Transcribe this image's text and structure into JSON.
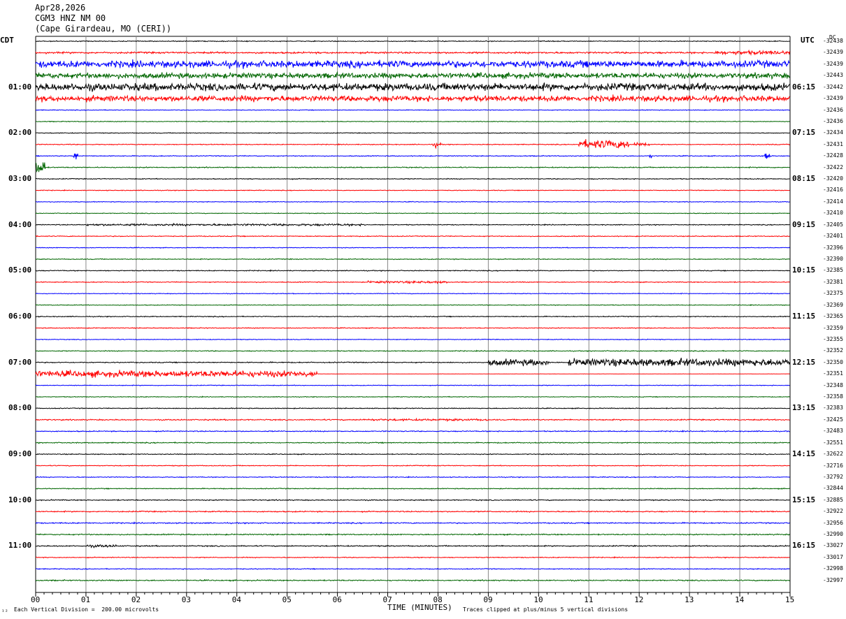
{
  "header": {
    "date": "Apr28,2026",
    "station": "CGM3 HNZ NM 00",
    "location": "(Cape Girardeau, MO (CERI))"
  },
  "left_tz": "CDT",
  "right_tz": "UTC",
  "dc_header": "DC",
  "footer": {
    "scale": "Each Vertical Division =  200.00 microvolts",
    "clip": "Traces clipped at plus/minus 5 vertical divisions",
    "xlabel": "TIME (MINUTES)",
    "corner_mark": "¹²"
  },
  "chart_data": {
    "type": "line",
    "title": "",
    "xlabel": "TIME (MINUTES)",
    "ylabel": "",
    "xlim": [
      0,
      15
    ],
    "x_ticks": [
      "00",
      "01",
      "02",
      "03",
      "04",
      "05",
      "06",
      "07",
      "08",
      "09",
      "10",
      "11",
      "12",
      "13",
      "14",
      "15"
    ],
    "trace_minutes": 15,
    "trace_colors": [
      "#000000",
      "#ff0000",
      "#0000ff",
      "#006600"
    ],
    "grid": true,
    "left_hour_labels": [
      "01:00",
      "02:00",
      "03:00",
      "04:00",
      "05:00",
      "06:00",
      "07:00",
      "08:00",
      "09:00",
      "10:00",
      "11:00"
    ],
    "right_hour_labels": [
      "06:15",
      "07:15",
      "08:15",
      "09:15",
      "10:15",
      "11:15",
      "12:15",
      "13:15",
      "14:15",
      "15:15",
      "16:15"
    ],
    "dc_offsets": [
      "-32438",
      "-32439",
      "-32439",
      "-32443",
      "-32442",
      "-32439",
      "-32436",
      "-32436",
      "-32434",
      "-32431",
      "-32428",
      "-32422",
      "-32420",
      "-32416",
      "-32414",
      "-32410",
      "-32405",
      "-32401",
      "-32396",
      "-32390",
      "-32385",
      "-32381",
      "-32375",
      "-32369",
      "-32365",
      "-32359",
      "-32355",
      "-32352",
      "-32350",
      "-32351",
      "-32348",
      "-32358",
      "-32383",
      "-32425",
      "-32483",
      "-32551",
      "-32622",
      "-32716",
      "-32792",
      "-32844",
      "-32885",
      "-32922",
      "-32956",
      "-32990",
      "-33027",
      "-33017",
      "-32998",
      "-32997"
    ],
    "noise_amplitude_divisions": [
      0.3,
      0.5,
      2.4,
      1.9,
      2.6,
      2.0,
      0.25,
      0.25,
      0.25,
      0.3,
      0.3,
      0.35,
      0.3,
      0.25,
      0.25,
      0.25,
      0.3,
      0.3,
      0.25,
      0.3,
      0.3,
      0.3,
      0.25,
      0.25,
      0.3,
      0.3,
      0.25,
      0.3,
      0.35,
      0.4,
      0.25,
      0.25,
      0.3,
      0.4,
      0.35,
      0.35,
      0.3,
      0.3,
      0.3,
      0.3,
      0.35,
      0.4,
      0.4,
      0.4,
      0.4,
      0.3,
      0.3,
      0.4
    ],
    "events": [
      {
        "trace": 1,
        "start": 0,
        "end": 15,
        "amp": 0.6
      },
      {
        "trace": 1,
        "start": 13.5,
        "end": 15,
        "amp": 1.4
      },
      {
        "trace": 9,
        "start": 7.9,
        "end": 8.05,
        "amp": 1.8
      },
      {
        "trace": 9,
        "start": 10.8,
        "end": 11.8,
        "amp": 3.0
      },
      {
        "trace": 9,
        "start": 11.9,
        "end": 12.2,
        "amp": 1.4
      },
      {
        "trace": 10,
        "start": 0.75,
        "end": 0.85,
        "amp": 3.0
      },
      {
        "trace": 10,
        "start": 12.2,
        "end": 12.25,
        "amp": 3.0
      },
      {
        "trace": 10,
        "start": 14.5,
        "end": 14.6,
        "amp": 2.6
      },
      {
        "trace": 11,
        "start": 0.0,
        "end": 0.2,
        "amp": 5.0
      },
      {
        "trace": 16,
        "start": 1.0,
        "end": 6.6,
        "amp": 0.7
      },
      {
        "trace": 21,
        "start": 6.6,
        "end": 8.2,
        "amp": 0.8
      },
      {
        "trace": 28,
        "start": 9.0,
        "end": 10.2,
        "amp": 2.2
      },
      {
        "trace": 28,
        "start": 10.6,
        "end": 15,
        "amp": 2.6
      },
      {
        "trace": 29,
        "start": 0.0,
        "end": 5.6,
        "amp": 2.2
      },
      {
        "trace": 33,
        "start": 6.5,
        "end": 9.0,
        "amp": 0.7
      },
      {
        "trace": 44,
        "start": 1.0,
        "end": 1.6,
        "amp": 0.9
      }
    ],
    "flat_after": [
      {
        "trace": 29,
        "from": 5.6
      }
    ]
  }
}
